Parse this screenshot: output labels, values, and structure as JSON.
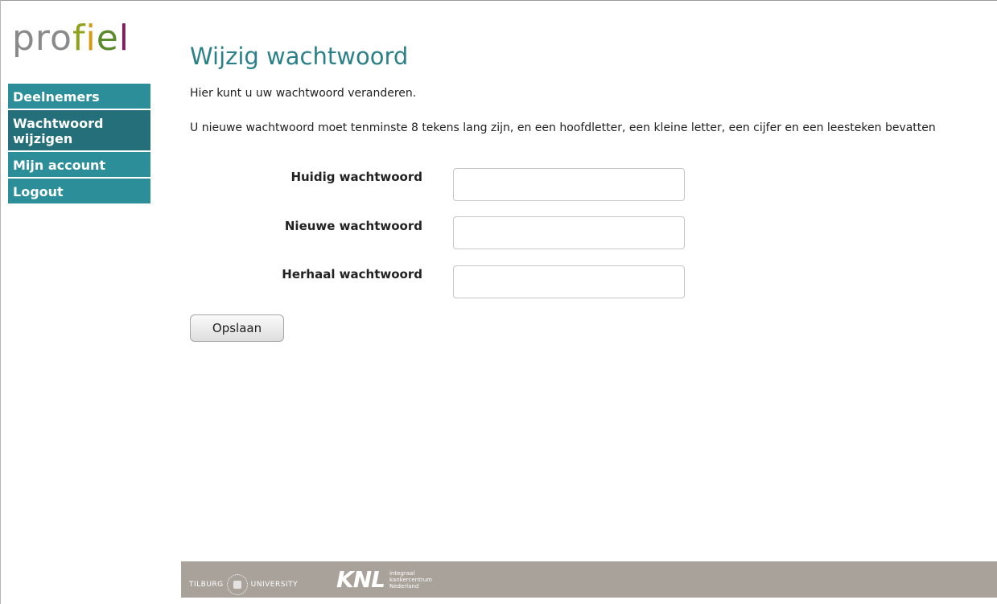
{
  "logo": {
    "text": "profiel"
  },
  "sidebar": {
    "items": [
      {
        "label": "Deelnemers"
      },
      {
        "label": "Wachtwoord wijzigen"
      },
      {
        "label": "Mijn account"
      },
      {
        "label": "Logout"
      }
    ]
  },
  "main": {
    "title": "Wijzig wachtwoord",
    "intro": "Hier kunt u uw wachtwoord veranderen.",
    "requirement": "U nieuwe wachtwoord moet tenminste 8 tekens lang zijn, en een hoofdletter, een kleine letter, een cijfer en een leesteken bevatten",
    "fields": [
      {
        "label": "Huidig wachtwoord",
        "value": ""
      },
      {
        "label": "Nieuwe wachtwoord",
        "value": ""
      },
      {
        "label": "Herhaal wachtwoord",
        "value": ""
      }
    ],
    "save_label": "Opslaan"
  },
  "footer": {
    "tilburg_left": "Tilburg",
    "tilburg_right": "University",
    "knl": "KNL",
    "knl_sub": [
      "integraal",
      "kankercentrum",
      "Nederland"
    ]
  },
  "colors": {
    "nav_bg": "#2c8e98",
    "nav_active": "#246f79",
    "title": "#2c8088",
    "footer_bg": "#a8a29b"
  }
}
